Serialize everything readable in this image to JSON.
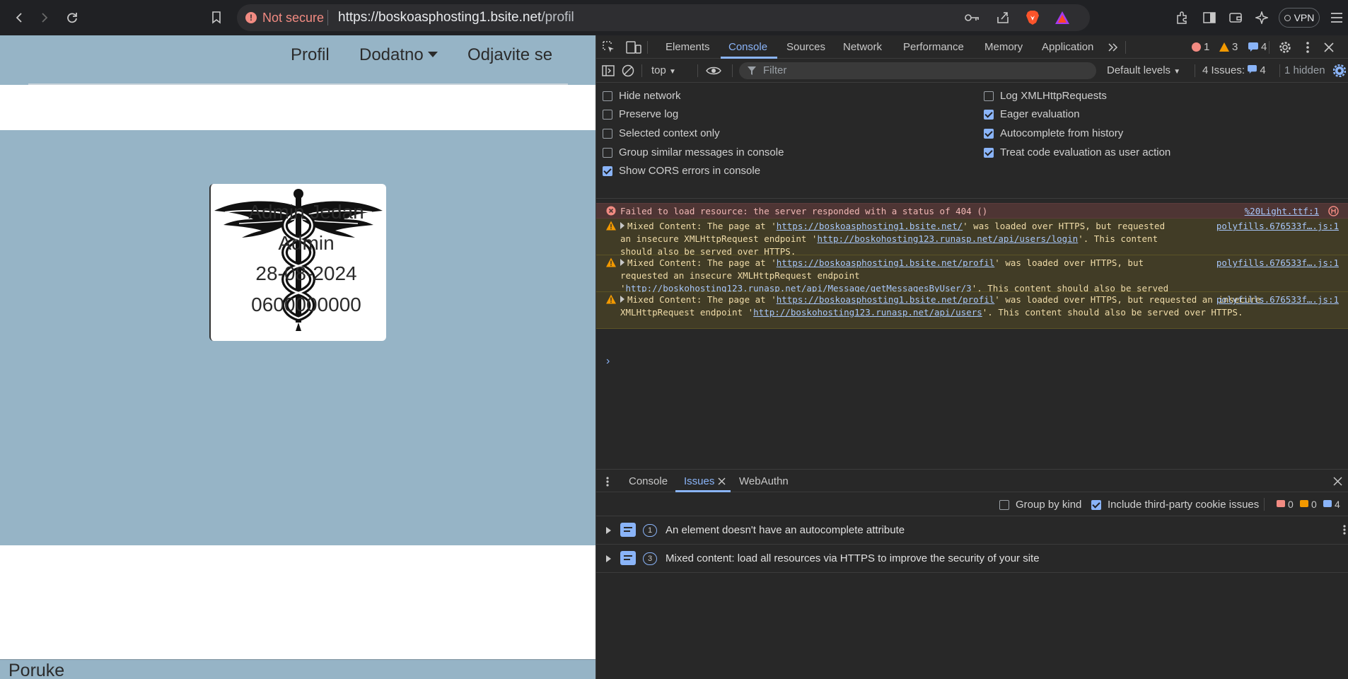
{
  "browser": {
    "not_secure": "Not secure",
    "url_host": "https://boskoasphosting1.bsite.net",
    "url_path": "/profil",
    "vpn": "VPN",
    "accent_error": "#f28b82"
  },
  "site": {
    "nav": {
      "profil": "Profil",
      "dodatno": "Dodatno",
      "odjavite": "Odjavite se"
    },
    "profile": {
      "name": "Admin Jedan",
      "role": "Admin",
      "date": "28-08-2024",
      "phone": "0600000000"
    },
    "poruke": "Poruke",
    "bg_color": "#96b4c6"
  },
  "devtools": {
    "tabs": [
      "Elements",
      "Console",
      "Sources",
      "Network",
      "Performance",
      "Memory",
      "Application"
    ],
    "counts": {
      "errors": "1",
      "warnings": "3",
      "infos": "4"
    },
    "toolbar": {
      "context": "top",
      "filter_placeholder": "Filter",
      "levels": "Default levels",
      "issues_label": "4 Issues:",
      "issues_count": "4",
      "hidden": "1 hidden"
    },
    "settings_left": [
      {
        "label": "Hide network",
        "checked": false
      },
      {
        "label": "Preserve log",
        "checked": false
      },
      {
        "label": "Selected context only",
        "checked": false
      },
      {
        "label": "Group similar messages in console",
        "checked": false
      },
      {
        "label": "Show CORS errors in console",
        "checked": true
      }
    ],
    "settings_right": [
      {
        "label": "Log XMLHttpRequests",
        "checked": false
      },
      {
        "label": "Eager evaluation",
        "checked": true
      },
      {
        "label": "Autocomplete from history",
        "checked": true
      },
      {
        "label": "Treat code evaluation as user action",
        "checked": true
      }
    ],
    "messages": {
      "error": {
        "text": "Failed to load resource: the server responded with a status of 404 ()",
        "source": "%20Light.ttf:1"
      },
      "warn1": {
        "a": "Mixed Content: The page at '",
        "page": "https://boskoasphosting1.bsite.net/",
        "b": "' was loaded over HTTPS, but requested an insecure XMLHttpRequest endpoint '",
        "endpoint": "http://boskohosting123.runasp.net/api/users/login",
        "c": "'. This content should also be served over HTTPS.",
        "source": "polyfills.676533f….js:1"
      },
      "warn2": {
        "a": "Mixed Content: The page at '",
        "page": "https://boskoasphosting1.bsite.net/profil",
        "b": "' was loaded over HTTPS, but requested an insecure XMLHttpRequest endpoint '",
        "endpoint": "http://boskohosting123.runasp.net/api/Message/getMessagesByUser/3",
        "c": "'. This content should also be served over HTTPS.",
        "source": "polyfills.676533f….js:1"
      },
      "warn3": {
        "a": "Mixed Content: The page at '",
        "page": "https://boskoasphosting1.bsite.net/profil",
        "b": "' was loaded over HTTPS, but requested an insecure XMLHttpRequest endpoint '",
        "endpoint": "http://boskohosting123.runasp.net/api/users",
        "c": "'. This content should also be served over HTTPS.",
        "source": "polyfills.676533f….js:1"
      }
    },
    "drawer": {
      "tabs": [
        "Console",
        "Issues",
        "WebAuthn"
      ],
      "group_by_kind": "Group by kind",
      "include_third_party": "Include third-party cookie issues",
      "counts": {
        "errors": "0",
        "warnings": "0",
        "infos": "4"
      },
      "issues": [
        {
          "count": "1",
          "text": "An element doesn't have an autocomplete attribute"
        },
        {
          "count": "3",
          "text": "Mixed content: load all resources via HTTPS to improve the security of your site"
        }
      ]
    }
  }
}
